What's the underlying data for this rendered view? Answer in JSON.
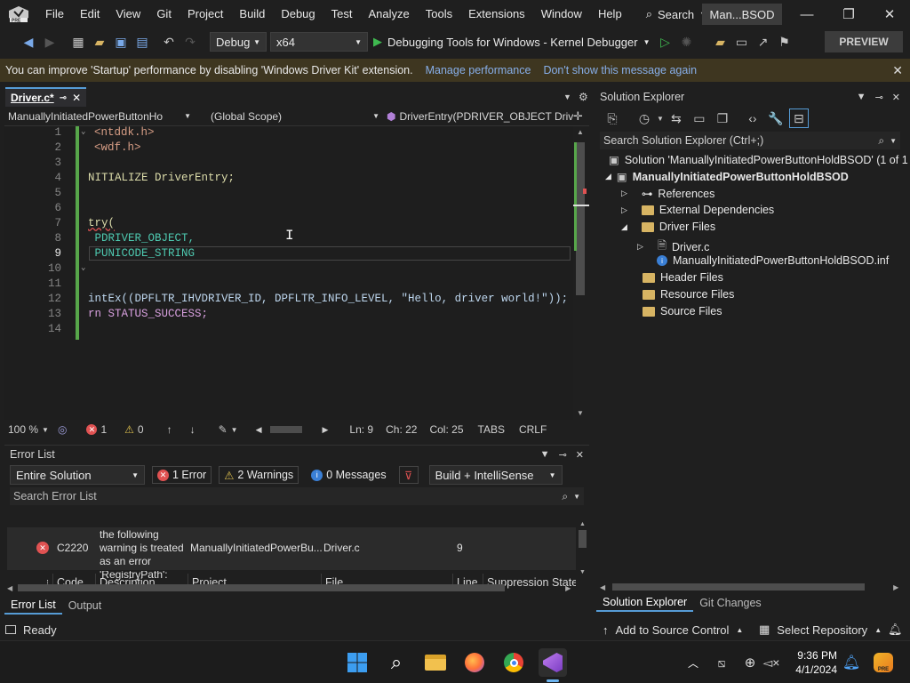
{
  "menu": {
    "items": [
      "File",
      "Edit",
      "View",
      "Git",
      "Project",
      "Build",
      "Debug",
      "Test",
      "Analyze",
      "Tools",
      "Extensions",
      "Window",
      "Help"
    ],
    "search": "Search",
    "solution_short": "Man...BSOD"
  },
  "toolbar": {
    "config": "Debug",
    "platform": "x64",
    "debugger": "Debugging Tools for Windows - Kernel Debugger",
    "preview": "PREVIEW"
  },
  "infobar": {
    "message": "You can improve 'Startup' performance by disabling 'Windows Driver Kit' extension.",
    "manage": "Manage performance",
    "dismiss": "Don't show this message again"
  },
  "editor": {
    "tab": "Driver.c*",
    "nav_project": "ManuallyInitiatedPowerButtonHo",
    "nav_scope": "(Global Scope)",
    "nav_func": "DriverEntry(PDRIVER_OBJECT Driv",
    "lines": [
      {
        "n": "1",
        "t": "<ntddk.h>"
      },
      {
        "n": "2",
        "t": "<wdf.h>"
      },
      {
        "n": "3",
        "t": ""
      },
      {
        "n": "4",
        "t": "NITIALIZE DriverEntry;"
      },
      {
        "n": "5",
        "t": ""
      },
      {
        "n": "6",
        "t": ""
      },
      {
        "n": "7",
        "t": "try("
      },
      {
        "n": "8",
        "t": " PDRIVER_OBJECT,"
      },
      {
        "n": "9",
        "t": " PUNICODE_STRING"
      },
      {
        "n": "10",
        "t": ""
      },
      {
        "n": "11",
        "t": ""
      },
      {
        "n": "12",
        "t": "intEx((DPFLTR_IHVDRIVER_ID, DPFLTR_INFO_LEVEL, \"Hello, driver world!\"));"
      },
      {
        "n": "13",
        "t": "rn STATUS_SUCCESS;"
      },
      {
        "n": "14",
        "t": ""
      }
    ],
    "status": {
      "zoom": "100 %",
      "errors": "1",
      "warnings": "0",
      "ln": "Ln: 9",
      "ch": "Ch: 22",
      "col": "Col: 25",
      "tabs": "TABS",
      "eol": "CRLF"
    }
  },
  "errorlist": {
    "title": "Error List",
    "scope": "Entire Solution",
    "errors": "1 Error",
    "warnings": "2 Warnings",
    "messages": "0 Messages",
    "source": "Build + IntelliSense",
    "search_placeholder": "Search Error List",
    "columns": [
      "Code",
      "Description",
      "Project",
      "File",
      "Line",
      "Suppression State"
    ],
    "row": {
      "code": "C2220",
      "desc1": "the following",
      "desc2": "warning is treated",
      "desc3": "as an error",
      "project": "ManuallyInitiatedPowerBu...",
      "file": "Driver.c",
      "line": "9"
    },
    "next_row_partial": "'RegistryPath':",
    "tabs": [
      "Error List",
      "Output"
    ]
  },
  "solution_explorer": {
    "title": "Solution Explorer",
    "search_placeholder": "Search Solution Explorer (Ctrl+;)",
    "solution": "Solution 'ManuallyInitiatedPowerButtonHoldBSOD' (1 of 1",
    "project": "ManuallyInitiatedPowerButtonHoldBSOD",
    "items": [
      "References",
      "External Dependencies",
      "Driver Files",
      "Driver.c",
      "ManuallyInitiatedPowerButtonHoldBSOD.inf",
      "Header Files",
      "Resource Files",
      "Source Files"
    ],
    "tabs": [
      "Solution Explorer",
      "Git Changes"
    ]
  },
  "statusbar": {
    "ready": "Ready",
    "add_source": "Add to Source Control",
    "select_repo": "Select Repository"
  },
  "taskbar": {
    "time": "9:36 PM",
    "date": "4/1/2024"
  }
}
